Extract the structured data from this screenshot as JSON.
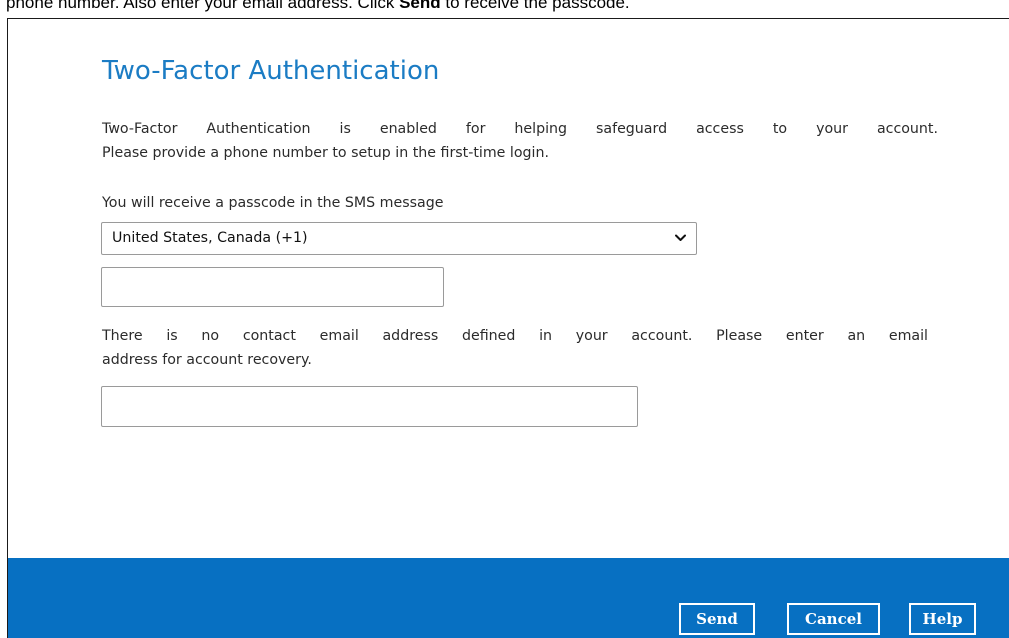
{
  "top_caption": {
    "before": "phone number. Also enter your email address. Click ",
    "bold": "Send",
    "after": " to receive the passcode."
  },
  "dialog": {
    "title": "Two-Factor Authentication",
    "intro_line_1": "Two-Factor Authentication is enabled for helping safeguard access to your account.",
    "intro_line_2": "Please provide a phone number to setup in the first-time login.",
    "sms_label": "You will receive a passcode in the SMS message",
    "country_select": {
      "selected_value": "United States, Canada (+1)",
      "icon": "chevron-down-icon"
    },
    "phone_input": {
      "value": "",
      "placeholder": ""
    },
    "email_note_line_1": "There is no contact email address defined in your account. Please enter an email",
    "email_note_line_2": "address for account recovery.",
    "email_input": {
      "value": "",
      "placeholder": ""
    }
  },
  "footer": {
    "background": "#0770c2",
    "send_label": "Send",
    "cancel_label": "Cancel",
    "help_label": "Help"
  },
  "colors": {
    "title": "#1b7cc4",
    "body_text": "#2b2b2b",
    "input_border": "#9a9a9a"
  }
}
